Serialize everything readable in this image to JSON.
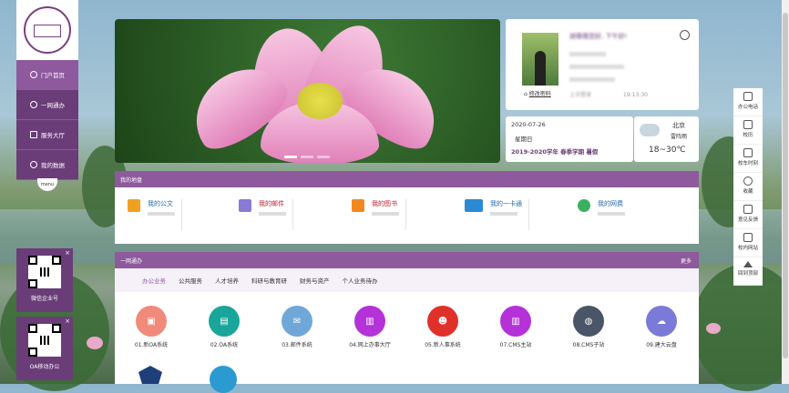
{
  "nav": {
    "items": [
      {
        "label": "门户首页",
        "active": true
      },
      {
        "label": "一网通办",
        "active": false
      },
      {
        "label": "服务大厅",
        "active": false
      },
      {
        "label": "我的数据",
        "active": false
      }
    ],
    "menu_label": "menu"
  },
  "qr": [
    {
      "label": "微信企业号",
      "close": "×"
    },
    {
      "label": "OA移动办公",
      "close": "×"
    }
  ],
  "user": {
    "greeting": "胡蓓蓓您好, 下午好!",
    "change_pwd": "修改密码",
    "last_login_time": "19:13:30",
    "last_login_label": "上次登录"
  },
  "date": {
    "date": "2020-07-26",
    "weekday": "星期日",
    "term": "2019-2020学年 春季学期 暑假"
  },
  "weather": {
    "city": "北京",
    "condition": "雷阵雨",
    "temp": "18~30℃"
  },
  "my_zone": {
    "title": "我的地盘",
    "items": [
      {
        "label": "我的公文",
        "color": "#f0a020"
      },
      {
        "label": "我的邮件",
        "color": "#8a7ad6"
      },
      {
        "label": "我的图书",
        "color": "#f08a20"
      },
      {
        "label": "我的一卡通",
        "color": "#2a8ad6"
      },
      {
        "label": "我的网费",
        "color": "#3ab060"
      }
    ]
  },
  "one_stop": {
    "title": "一网通办",
    "more": "更多",
    "tabs": [
      {
        "label": "办公业务",
        "active": true
      },
      {
        "label": "公共服务",
        "active": false
      },
      {
        "label": "人才培养",
        "active": false
      },
      {
        "label": "科研与教育研",
        "active": false
      },
      {
        "label": "财务与资产",
        "active": false
      },
      {
        "label": "个人业务待办",
        "active": false
      }
    ],
    "apps": [
      {
        "label": "01.新OA系统",
        "color": "#f08a7a",
        "glyph": "▣"
      },
      {
        "label": "02.OA系统",
        "color": "#1aa59a",
        "glyph": "▤"
      },
      {
        "label": "03.邮件系统",
        "color": "#6fa8d8",
        "glyph": "✉"
      },
      {
        "label": "04.网上办事大厅",
        "color": "#b432d8",
        "glyph": "▥"
      },
      {
        "label": "05.新人事系统",
        "color": "#e0302a",
        "glyph": "☻"
      },
      {
        "label": "07.CMS主站",
        "color": "#b432d8",
        "glyph": "▥"
      },
      {
        "label": "08.CMS子站",
        "color": "#4a5568",
        "glyph": "◍"
      },
      {
        "label": "09.建大云盘",
        "color": "#7a7ad8",
        "glyph": "☁"
      }
    ]
  },
  "right_tools": [
    {
      "label": "办公电话"
    },
    {
      "label": "校历"
    },
    {
      "label": "校车时刻"
    },
    {
      "label": "收藏"
    },
    {
      "label": "意见反馈"
    },
    {
      "label": "校内网站"
    },
    {
      "label": "回到顶部"
    }
  ]
}
